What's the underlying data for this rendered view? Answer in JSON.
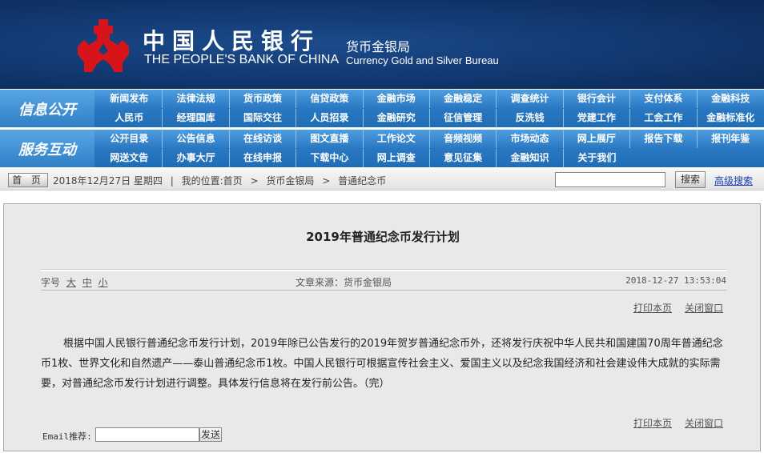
{
  "header": {
    "cn_name": "中国人民银行",
    "en_name": "THE PEOPLE'S BANK OF CHINA",
    "bureau_cn": "货币金银局",
    "bureau_en": "Currency  Gold and Silver Bureau"
  },
  "nav": {
    "sections": [
      {
        "label": "信息公开",
        "rows": [
          [
            "新闻发布",
            "法律法规",
            "货币政策",
            "信贷政策",
            "金融市场",
            "金融稳定",
            "调查统计",
            "银行会计",
            "支付体系",
            "金融科技"
          ],
          [
            "人民币",
            "经理国库",
            "国际交往",
            "人员招录",
            "金融研究",
            "征信管理",
            "反洗钱",
            "党建工作",
            "工会工作",
            "金融标准化"
          ]
        ]
      },
      {
        "label": "服务互动",
        "rows": [
          [
            "公开目录",
            "公告信息",
            "在线访谈",
            "图文直播",
            "工作论文",
            "音频视频",
            "市场动态",
            "网上展厅",
            "报告下载",
            "报刊年鉴"
          ],
          [
            "网送文告",
            "办事大厅",
            "在线申报",
            "下载中心",
            "网上调查",
            "意见征集",
            "金融知识",
            "关于我们"
          ]
        ]
      }
    ]
  },
  "breadcrumb": {
    "home": "首 页",
    "date": "2018年12月27日 星期四",
    "sep": "|",
    "location_label": "我的位置:首页",
    "arrow": ">",
    "items": [
      "货币金银局",
      "普通纪念币"
    ]
  },
  "search": {
    "button": "搜索",
    "advanced": "高级搜索",
    "value": ""
  },
  "article": {
    "title": "2019年普通纪念币发行计划",
    "fontsize_label": "字号",
    "fontsize_options": [
      "大",
      "中",
      "小"
    ],
    "source": "文章来源：货币金银局",
    "datetime": "2018-12-27 13:53:04",
    "print": "打印本页",
    "close": "关闭窗口",
    "body": "根据中国人民银行普通纪念币发行计划，2019年除已公告发行的2019年贺岁普通纪念币外，还将发行庆祝中华人民共和国建国70周年普通纪念币1枚、世界文化和自然遗产——泰山普通纪念币1枚。中国人民银行可根据宣传社会主义、爱国主义以及纪念我国经济和社会建设伟大成就的实际需要，对普通纪念币发行计划进行调整。具体发行信息将在发行前公告。（完）"
  },
  "email": {
    "label": "Email推荐:",
    "value": "",
    "send": "发送"
  }
}
